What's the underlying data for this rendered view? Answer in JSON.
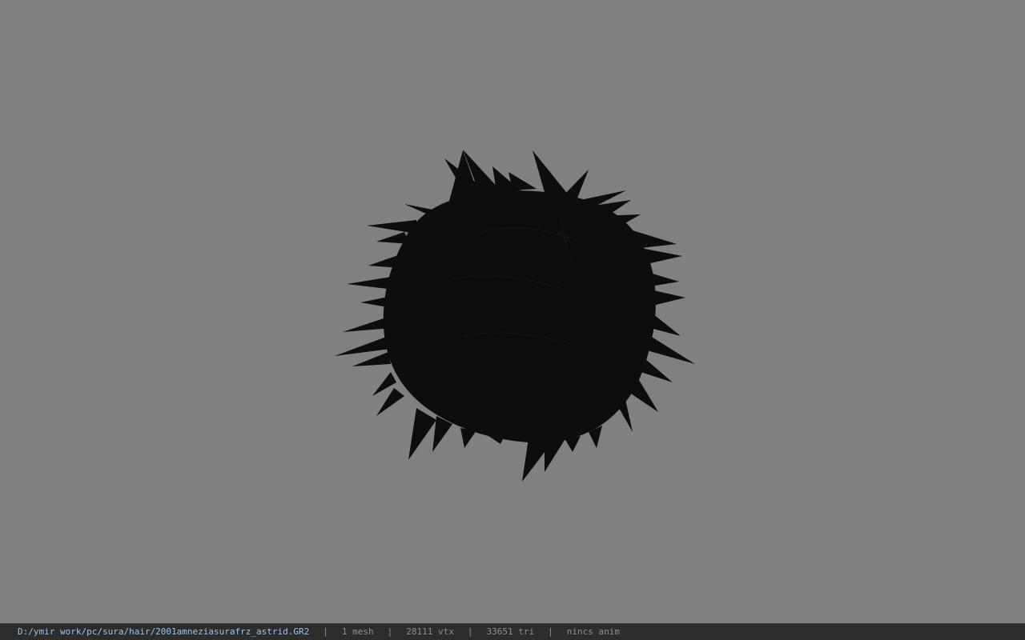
{
  "viewport": {
    "background_color": "#808080",
    "model": {
      "icon": "hair-mesh-render",
      "color": "#0d0d0d"
    }
  },
  "statusbar": {
    "file_path": "D:/ymir work/pc/sura/hair/2001amneziasurafrz_astrid.GR2",
    "separator": "|",
    "mesh_count": "1 mesh",
    "vertex_count": "28111 vtx",
    "triangle_count": "33651 tri",
    "anim_status": "nincs anim",
    "colors": {
      "background": "#2d2d2d",
      "path": "#9cc3e6",
      "text": "#8e8e8e"
    }
  }
}
